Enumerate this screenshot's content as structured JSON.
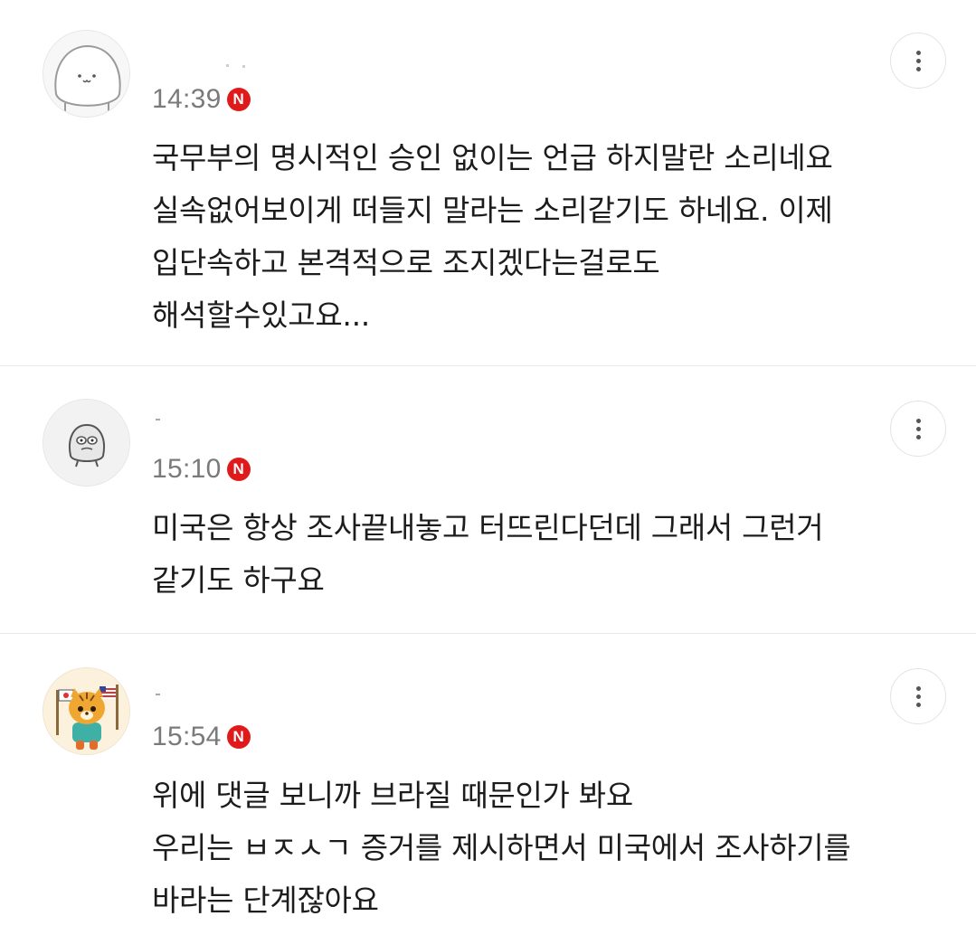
{
  "comments": [
    {
      "avatar_icon": "white-cat-face-avatar",
      "time": "14:39",
      "badge": "N",
      "text": "국무부의 명시적인 승인 없이는 언급 하지말란 소리네요\n실속없어보이게 떠들지 말라는 소리같기도 하네요. 이제\n입단속하고 본격적으로 조지겠다는걸로도\n해석할수있고요...",
      "more_icon": "more-vertical-icon"
    },
    {
      "avatar_icon": "grey-blob-character-avatar",
      "time": "15:10",
      "badge": "N",
      "text": "미국은 항상 조사끝내놓고 터뜨린다던데 그래서 그런거\n같기도 하구요",
      "more_icon": "more-vertical-icon"
    },
    {
      "avatar_icon": "tiger-with-flags-avatar",
      "time": "15:54",
      "badge": "N",
      "text": "위에 댓글 보니까 브라질 때문인가 봐요\n우리는 ㅂㅈㅅㄱ 증거를 제시하면서 미국에서 조사하기를\n바라는 단계잖아요",
      "more_icon": "more-vertical-icon"
    }
  ],
  "colors": {
    "badge": "#e01a1a",
    "time": "#7a7a7a",
    "text": "#1c1c1c",
    "divider": "#e8e8e8"
  }
}
